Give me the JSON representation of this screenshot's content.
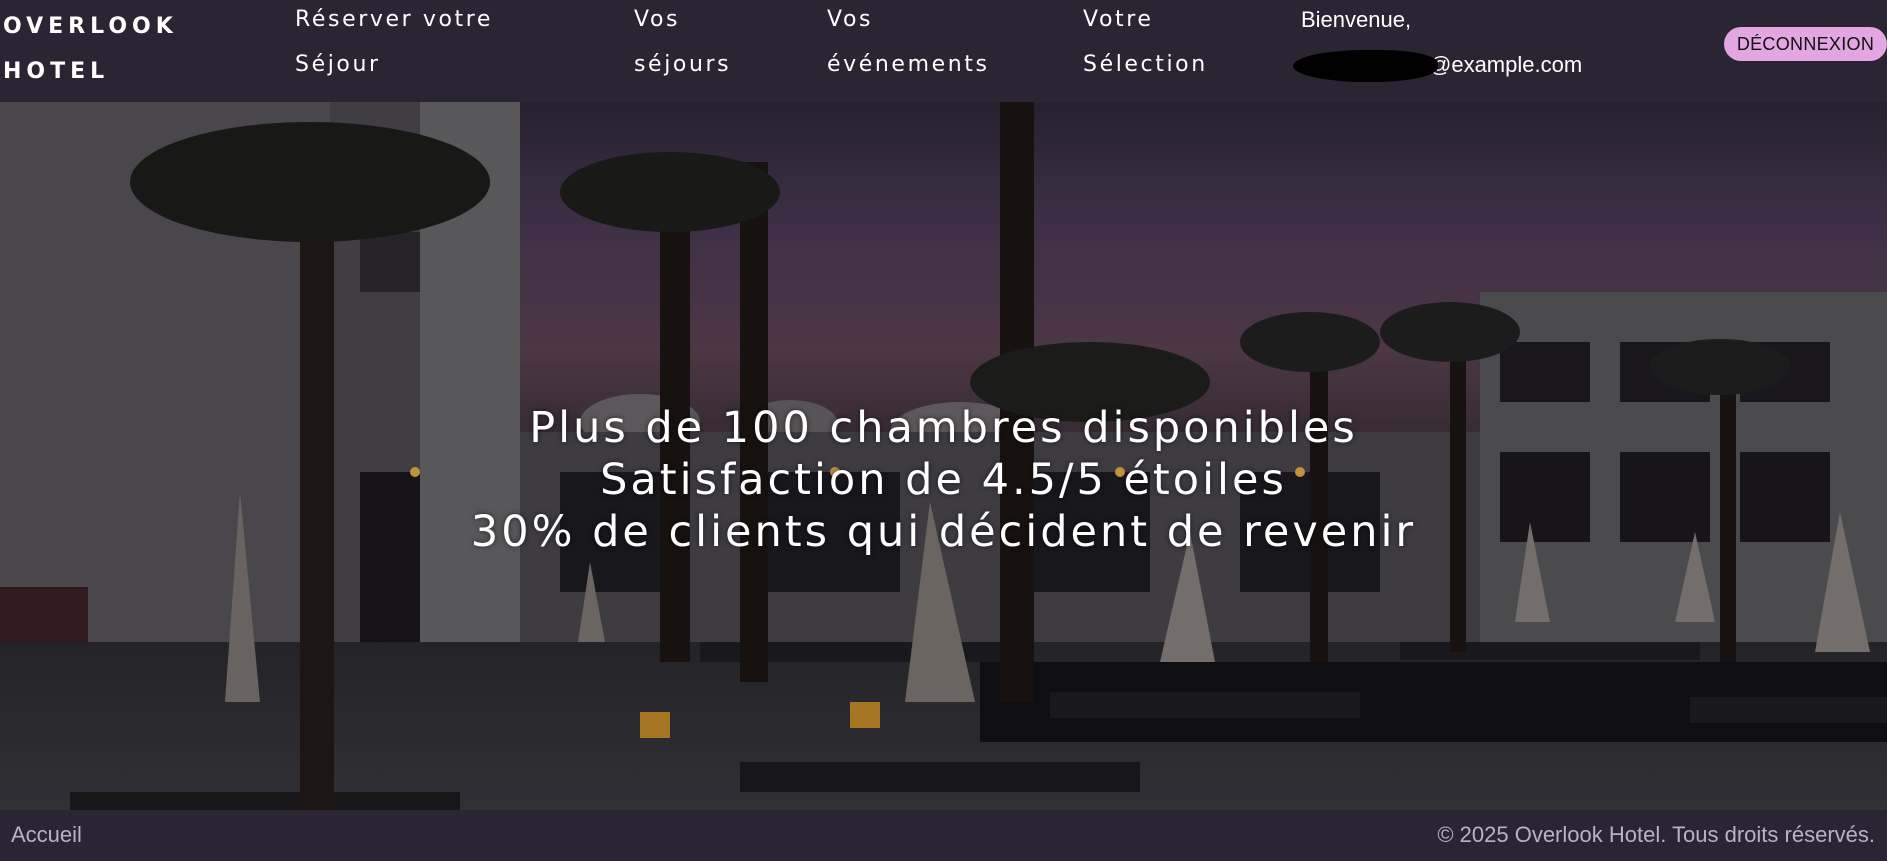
{
  "header": {
    "logo_line1": "OVERLOOK",
    "logo_line2": "HOTEL",
    "nav": [
      {
        "line1": "Réserver votre",
        "line2": "Séjour"
      },
      {
        "line1": "Vos",
        "line2": "séjours"
      },
      {
        "line1": "Vos",
        "line2": "événements"
      },
      {
        "line1": "Votre",
        "line2": "Sélection"
      }
    ],
    "welcome_label": "Bienvenue,",
    "email_suffix": "@example.com",
    "logout_label": "DÉCONNEXION"
  },
  "hero": {
    "lines": [
      "Plus de 100 chambres disponibles",
      "Satisfaction de 4.5/5 étoiles",
      "30% de clients qui décident de revenir"
    ]
  },
  "footer": {
    "home_label": "Accueil",
    "copyright": "© 2025 Overlook Hotel. Tous droits réservés."
  },
  "colors": {
    "header_bg": "#2b2533",
    "logout_bg": "#e3a6e0",
    "footer_text": "#b9b3c0"
  }
}
